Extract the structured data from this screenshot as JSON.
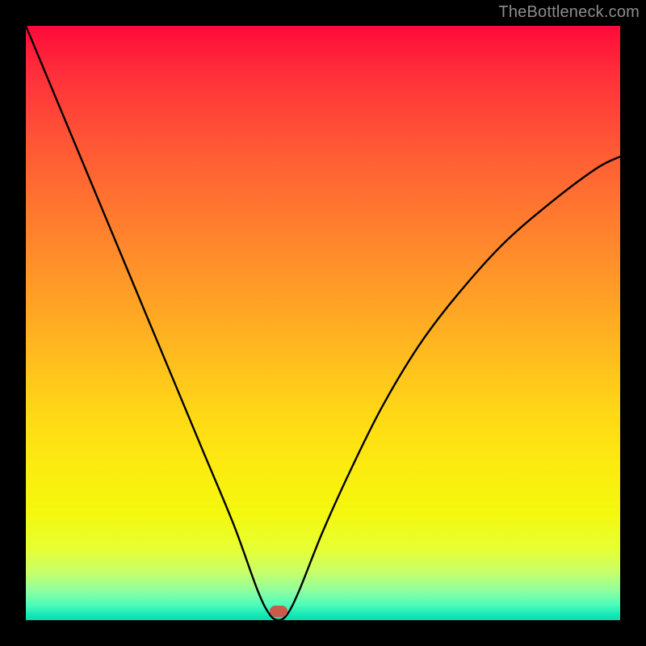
{
  "watermark": "TheBottleneck.com",
  "chart_data": {
    "type": "line",
    "title": "",
    "xlabel": "",
    "ylabel": "",
    "xlim": [
      0,
      100
    ],
    "ylim": [
      0,
      100
    ],
    "grid": false,
    "legend": false,
    "background_gradient": {
      "top_color": "#ff0a3a",
      "bottom_color": "#0fd8a8",
      "meaning": "red=high bottleneck, green=low bottleneck"
    },
    "series": [
      {
        "name": "bottleneck-curve",
        "color": "#000000",
        "x": [
          0,
          5,
          10,
          15,
          20,
          25,
          30,
          35,
          39,
          41,
          42.5,
          44,
          46,
          50,
          55,
          60,
          66,
          72,
          80,
          88,
          96,
          100
        ],
        "values": [
          100,
          88,
          76,
          64,
          52,
          40,
          28,
          16,
          5,
          1,
          0,
          1,
          5,
          15,
          26,
          36,
          46,
          54,
          63,
          70,
          76,
          78
        ]
      }
    ],
    "annotations": [
      {
        "name": "optimal-point-marker",
        "x": 42.5,
        "y": 1.5,
        "shape": "pill",
        "color": "#cc5a4a"
      }
    ]
  }
}
